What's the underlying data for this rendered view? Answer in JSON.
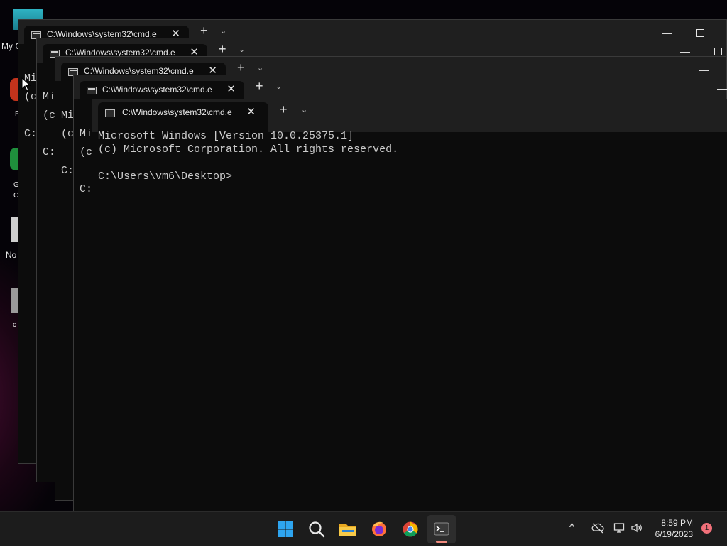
{
  "desktop": {
    "icon_labels": [
      "My C",
      "F",
      "G",
      "C",
      "No",
      "c"
    ]
  },
  "windows": [
    {
      "tab_title": "C:\\Windows\\system32\\cmd.e",
      "peek_lines": [
        "Mi",
        "(c",
        "",
        "C:"
      ]
    },
    {
      "tab_title": "C:\\Windows\\system32\\cmd.e",
      "peek_lines": [
        "Mi",
        "(c",
        "",
        "C:"
      ]
    },
    {
      "tab_title": "C:\\Windows\\system32\\cmd.e",
      "peek_lines": [
        "Mi",
        "(c",
        "",
        "C:"
      ]
    },
    {
      "tab_title": "C:\\Windows\\system32\\cmd.e",
      "peek_lines": [
        "Mi",
        "(c",
        "",
        "C:"
      ]
    },
    {
      "tab_title": "C:\\Windows\\system32\\cmd.e",
      "peek_lines": []
    }
  ],
  "front_window": {
    "tab_title": "C:\\Windows\\system32\\cmd.e",
    "close_glyph": "✕",
    "new_tab_glyph": "+",
    "menu_glyph": "⌄",
    "console_lines": [
      "Microsoft Windows [Version 10.0.25375.1]",
      "(c) Microsoft Corporation. All rights reserved.",
      "",
      "C:\\Users\\vm6\\Desktop>"
    ]
  },
  "taskbar": {
    "apps": [
      {
        "name": "start-icon"
      },
      {
        "name": "search-icon"
      },
      {
        "name": "file-explorer-icon"
      },
      {
        "name": "firefox-icon"
      },
      {
        "name": "chrome-icon"
      },
      {
        "name": "terminal-icon",
        "active": true
      }
    ],
    "tray": {
      "chevron": "^",
      "time": "8:59 PM",
      "date": "6/19/2023",
      "notification_count": "1"
    }
  },
  "colors": {
    "terminal_bg": "#0c0c0c",
    "titlebar_bg": "#1f1f1f",
    "taskbar_bg": "#1c1c1c",
    "accent_indicator": "#f08a7e"
  }
}
